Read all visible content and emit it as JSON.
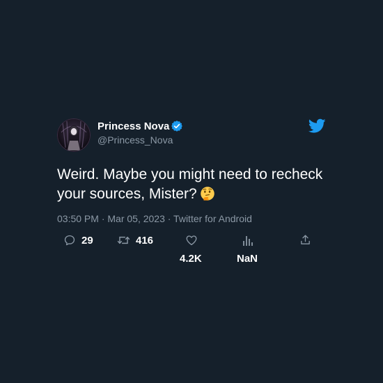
{
  "author": {
    "display_name": "Princess Nova",
    "handle": "@Princess_Nova",
    "verified": true,
    "avatar_icon": "avatar-icon"
  },
  "brand": {
    "logo_icon": "twitter-bird-icon",
    "accent_color": "#1d9bf0",
    "background_color": "#15202b"
  },
  "tweet": {
    "text": "Weird. Maybe you might need to recheck your sources, Mister?",
    "emoji_icon": "thinking-face-icon"
  },
  "meta": {
    "line": "03:50 PM · Mar 05, 2023 · Twitter for Android"
  },
  "actions": {
    "replies": "29",
    "retweets": "416",
    "likes": "4.2K",
    "views": "NaN"
  }
}
